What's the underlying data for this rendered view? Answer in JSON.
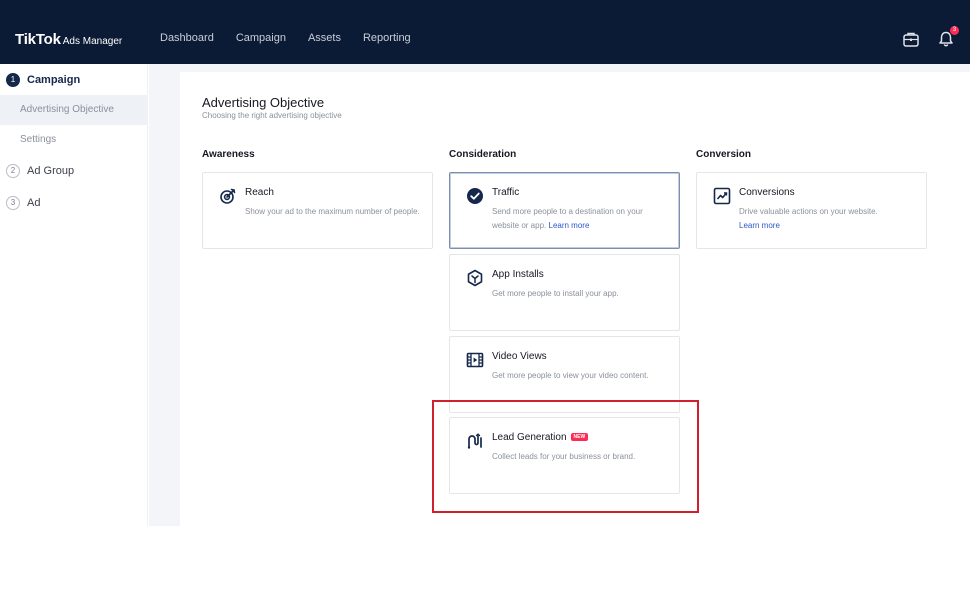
{
  "header": {
    "logo": "TikTok",
    "logo_sub": "Ads Manager",
    "nav": [
      "Dashboard",
      "Campaign",
      "Assets",
      "Reporting"
    ],
    "notification_count": "3",
    "icons": {
      "briefcase": "briefcase-icon",
      "bell": "bell-icon"
    }
  },
  "sidebar": {
    "steps": [
      {
        "num": "1",
        "label": "Campaign"
      },
      {
        "num": "2",
        "label": "Ad Group"
      },
      {
        "num": "3",
        "label": "Ad"
      }
    ],
    "sub_items": [
      "Advertising Objective",
      "Settings"
    ]
  },
  "main": {
    "title": "Advertising Objective",
    "subtitle": "Choosing the right advertising objective",
    "columns": [
      "Awareness",
      "Consideration",
      "Conversion"
    ],
    "cards": {
      "reach": {
        "title": "Reach",
        "desc": "Show your ad to the maximum number of people."
      },
      "traffic": {
        "title": "Traffic",
        "desc": "Send more people to a destination on your website or app.",
        "link": "Learn more"
      },
      "conversions": {
        "title": "Conversions",
        "desc": "Drive valuable actions on your website.",
        "link": "Learn more"
      },
      "app_installs": {
        "title": "App Installs",
        "desc": "Get more people to install your app."
      },
      "video_views": {
        "title": "Video Views",
        "desc": "Get more people to view your video content."
      },
      "lead_generation": {
        "title": "Lead Generation",
        "badge": "NEW",
        "desc": "Collect leads for your business or brand."
      }
    }
  },
  "colors": {
    "navbar": "#0b1a35",
    "accent": "#14284b",
    "link": "#2a58c8",
    "highlight": "#d0202e",
    "badge": "#fe2c55"
  }
}
